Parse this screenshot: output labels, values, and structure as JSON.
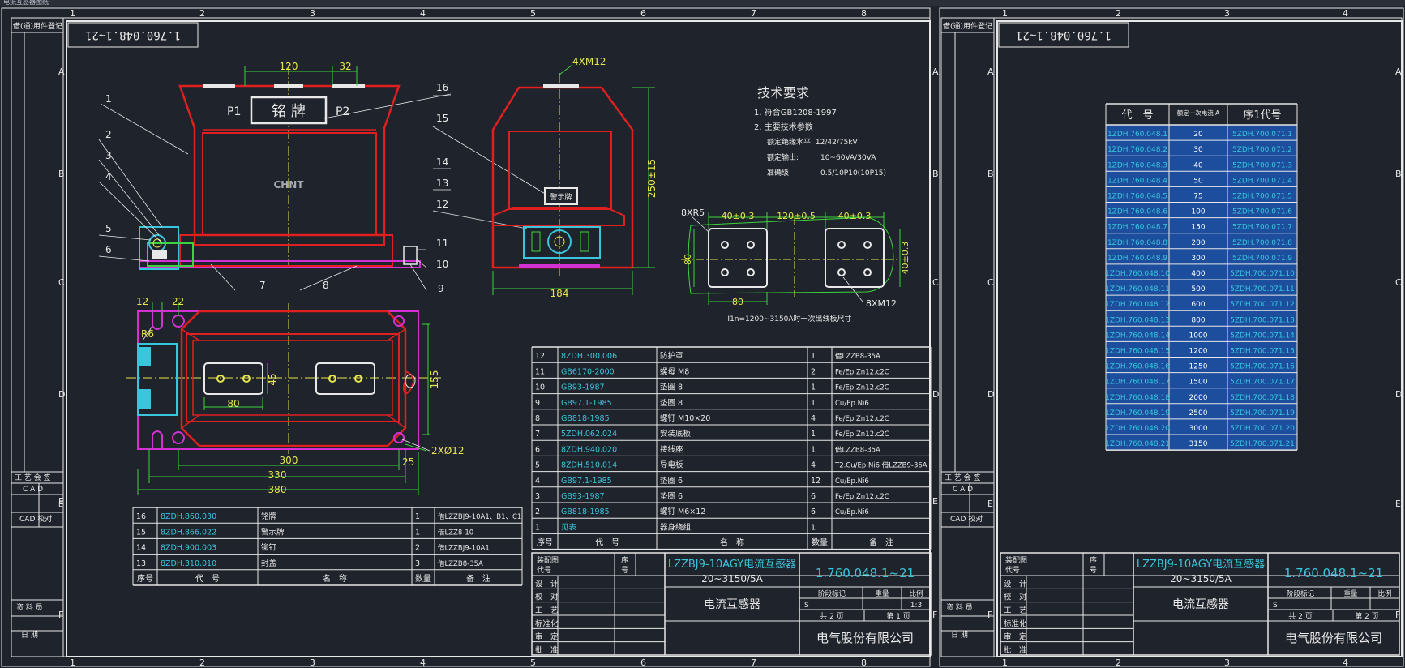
{
  "window": {
    "tab_title": "电流互感器图纸"
  },
  "colors": {
    "background": "#1f232b",
    "frame": "#e8e8e8",
    "outline": "#e02020",
    "magenta": "#d430d4",
    "cyan": "#39c6dc",
    "dimension": "#3cd43c",
    "yellow": "#e6e64a",
    "table_highlight": "#1d4e9e"
  },
  "left_sheet": {
    "zone_numbers": [
      "1",
      "2",
      "3",
      "4",
      "5",
      "6",
      "7",
      "8"
    ],
    "zone_letters": [
      "A",
      "B",
      "C",
      "D",
      "E",
      "F"
    ],
    "drawing_number_box": "1.760.048.1~21",
    "side_labels": {
      "top": "借(通)用件登记",
      "gongyi": "工 艺 会 签",
      "cad": "C A D",
      "e": "E",
      "cad_jiao": "CAD 校对",
      "ziliao": "资 料 员",
      "riqi": "日 期"
    },
    "part_callouts": [
      "1",
      "2",
      "3",
      "4",
      "5",
      "6",
      "7",
      "8",
      "9",
      "11",
      "10",
      "12",
      "13",
      "14",
      "15",
      "16"
    ],
    "logo": "CHNT",
    "nameplate": "铭 牌",
    "p1": "P1",
    "p2": "P2",
    "warning_label": "警示牌",
    "dims": {
      "d120": "120",
      "d32": "32",
      "m12": "4XM12",
      "h250": "250±15",
      "d184": "184",
      "d12": "12",
      "d22": "22",
      "r6": "R6",
      "d45": "45",
      "d80": "80",
      "d155": "155",
      "d300": "300",
      "d330": "330",
      "d380": "380",
      "d25": "25",
      "holes": "2XØ12"
    },
    "tech_req": {
      "title": "技术要求",
      "line1": "1. 符合GB1208-1997",
      "line2": "2. 主要技术参数",
      "line3": "额定绝缘水平: 12/42/75kV",
      "line4_label": "额定输出:",
      "line4_value": "10~60VA/30VA",
      "line5_label": "准确级:",
      "line5_value": "0.5/10P10(10P15)"
    },
    "terminal": {
      "r5": "8XR5",
      "d40a": "40±0.3",
      "d120": "120±0.5",
      "d40b": "40±0.3",
      "d80v": "80",
      "d40v": "40±0.3",
      "d80h": "80",
      "m12": "8XM12",
      "note": "I1n=1200~3150A时一次出线板尺寸"
    },
    "bom_upper": {
      "rows": [
        {
          "no": "12",
          "code": "8ZDH.300.006",
          "name": "防护罩",
          "qty": "1",
          "note": "借LZZB8-35A"
        },
        {
          "no": "11",
          "code": "GB6170-2000",
          "name": "螺母 M8",
          "qty": "2",
          "note": "Fe/Ep.Zn12.c2C"
        },
        {
          "no": "10",
          "code": "GB93-1987",
          "name": "垫圈 8",
          "qty": "1",
          "note": "Fe/Ep.Zn12.c2C"
        },
        {
          "no": "9",
          "code": "GB97.1-1985",
          "name": "垫圈 8",
          "qty": "1",
          "note": "Cu/Ep.Ni6"
        },
        {
          "no": "8",
          "code": "GB818-1985",
          "name": "螺钉 M10×20",
          "qty": "4",
          "note": "Fe/Ep.Zn12.c2C"
        },
        {
          "no": "7",
          "code": "5ZDH.062.024",
          "name": "安装底板",
          "qty": "1",
          "note": "Fe/Ep.Zn12.c2C"
        },
        {
          "no": "6",
          "code": "8ZDH.940.020",
          "name": "接线座",
          "qty": "1",
          "note": "借LZZB8-35A"
        },
        {
          "no": "5",
          "code": "8ZDH.510.014",
          "name": "导电板",
          "qty": "4",
          "note": "T2.Cu/Ep.Ni6 借LZZB9-36A"
        },
        {
          "no": "4",
          "code": "GB97.1-1985",
          "name": "垫圈 6",
          "qty": "12",
          "note": "Cu/Ep.Ni6"
        },
        {
          "no": "3",
          "code": "GB93-1987",
          "name": "垫圈 6",
          "qty": "6",
          "note": "Fe/Ep.Zn12.c2C"
        },
        {
          "no": "2",
          "code": "GB818-1985",
          "name": "螺钉 M6×12",
          "qty": "6",
          "note": "Cu/Ep.Ni6"
        },
        {
          "no": "1",
          "code": "见表",
          "name": "器身绕组",
          "qty": "1",
          "note": ""
        }
      ],
      "header": {
        "no": "序号",
        "code": "代　号",
        "name": "名　称",
        "qty": "数量",
        "note": "备　注"
      }
    },
    "bom_lower": {
      "rows": [
        {
          "no": "16",
          "code": "8ZDH.860.030",
          "name": "铭牌",
          "qty": "1",
          "note": "借LZZBJ9-10A1、B1、C1"
        },
        {
          "no": "15",
          "code": "8ZDH.866.022",
          "name": "警示牌",
          "qty": "1",
          "note": "借LZZ8-10"
        },
        {
          "no": "14",
          "code": "8ZDH.900.003",
          "name": "铆钉",
          "qty": "2",
          "note": "借LZZBJ9-10A1"
        },
        {
          "no": "13",
          "code": "8ZDH.310.010",
          "name": "封盖",
          "qty": "3",
          "note": "借LZZB8-35A"
        }
      ],
      "header": {
        "no": "序号",
        "code": "代　号",
        "name": "名　称",
        "qty": "数量",
        "note": "备　注"
      }
    },
    "title_block": {
      "ref_label_1": "装配图",
      "ref_label_2": "代号",
      "order_label_1": "序",
      "order_label_2": "号",
      "product_name": "LZZBJ9-10AGY电流互感器",
      "rating": "20~3150/5A",
      "drawing_no": "1.760.048.1~21",
      "category": "电流互感器",
      "company": "电气股份有限公司",
      "roles": [
        "设　计",
        "校　对",
        "工　艺",
        "标准化",
        "审　定",
        "批　准"
      ],
      "col_heads": [
        "阶段标记",
        "重量",
        "比例"
      ],
      "stage": "S",
      "scale": "1:3",
      "total": "共 2 页",
      "page": "第 1 页"
    }
  },
  "right_sheet": {
    "zone_numbers": [
      "1",
      "2",
      "3",
      "4"
    ],
    "zone_letters": [
      "A",
      "B",
      "C",
      "D",
      "E",
      "F"
    ],
    "drawing_number_box": "1.760.048.1~21",
    "side_labels": {
      "top": "借(通)用件登记",
      "gongyi": "工 艺 会 签",
      "cad": "C A D",
      "e": "E",
      "cad_jiao": "CAD 校对",
      "ziliao": "资 料 员",
      "riqi": "日 期"
    },
    "table": {
      "headers": [
        "代　号",
        "额定一次电流 A",
        "序1代号"
      ],
      "rows": [
        [
          "1ZDH.760.048.1",
          "20",
          "5ZDH.700.071.1"
        ],
        [
          "1ZDH.760.048.2",
          "30",
          "5ZDH.700.071.2"
        ],
        [
          "1ZDH.760.048.3",
          "40",
          "5ZDH.700.071.3"
        ],
        [
          "1ZDH.760.048.4",
          "50",
          "5ZDH.700.071.4"
        ],
        [
          "1ZDH.760.048.5",
          "75",
          "5ZDH.700.071.5"
        ],
        [
          "1ZDH.760.048.6",
          "100",
          "5ZDH.700.071.6"
        ],
        [
          "1ZDH.760.048.7",
          "150",
          "5ZDH.700.071.7"
        ],
        [
          "1ZDH.760.048.8",
          "200",
          "5ZDH.700.071.8"
        ],
        [
          "1ZDH.760.048.9",
          "300",
          "5ZDH.700.071.9"
        ],
        [
          "1ZDH.760.048.10",
          "400",
          "5ZDH.700.071.10"
        ],
        [
          "1ZDH.760.048.11",
          "500",
          "5ZDH.700.071.11"
        ],
        [
          "1ZDH.760.048.12",
          "600",
          "5ZDH.700.071.12"
        ],
        [
          "1ZDH.760.048.13",
          "800",
          "5ZDH.700.071.13"
        ],
        [
          "1ZDH.760.048.14",
          "1000",
          "5ZDH.700.071.14"
        ],
        [
          "1ZDH.760.048.15",
          "1200",
          "5ZDH.700.071.15"
        ],
        [
          "1ZDH.760.048.16",
          "1250",
          "5ZDH.700.071.16"
        ],
        [
          "1ZDH.760.048.17",
          "1500",
          "5ZDH.700.071.17"
        ],
        [
          "1ZDH.760.048.18",
          "2000",
          "5ZDH.700.071.18"
        ],
        [
          "1ZDH.760.048.19",
          "2500",
          "5ZDH.700.071.19"
        ],
        [
          "1ZDH.760.048.20",
          "3000",
          "5ZDH.700.071.20"
        ],
        [
          "1ZDH.760.048.21",
          "3150",
          "5ZDH.700.071.21"
        ]
      ]
    },
    "title_block": {
      "ref_label_1": "装配图",
      "ref_label_2": "代号",
      "order_label_1": "序",
      "order_label_2": "号",
      "product_name": "LZZBJ9-10AGY电流互感器",
      "rating": "20~3150/5A",
      "drawing_no": "1.760.048.1~21",
      "category": "电流互感器",
      "company": "电气股份有限公司",
      "roles": [
        "设　计",
        "校　对",
        "工　艺",
        "标准化",
        "审　定",
        "批　准"
      ],
      "col_heads": [
        "阶段标记",
        "重量",
        "比例"
      ],
      "stage": "S",
      "total": "共 2 页",
      "page": "第 2 页"
    }
  }
}
